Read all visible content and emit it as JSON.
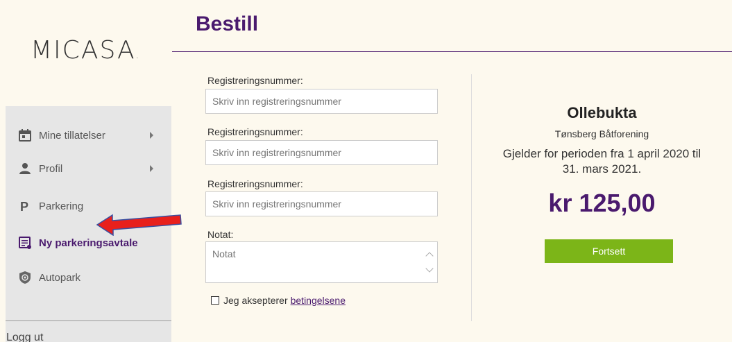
{
  "sidebar": {
    "logo": "MICASA",
    "logo_suffix": ".",
    "items": [
      {
        "label": "Mine tillatelser",
        "icon": "calendar-icon",
        "has_submenu": true,
        "active": false
      },
      {
        "label": "Profil",
        "icon": "person-icon",
        "has_submenu": true,
        "active": false
      },
      {
        "label": "Parkering",
        "icon": "parking-icon",
        "has_submenu": false,
        "active": false
      },
      {
        "label": "Ny parkeringsavtale",
        "icon": "document-icon",
        "has_submenu": false,
        "active": true
      },
      {
        "label": "Autopark",
        "icon": "shield-icon",
        "has_submenu": false,
        "active": false
      }
    ],
    "logout": "Logg ut"
  },
  "header": {
    "title": "Bestill"
  },
  "form": {
    "fields": [
      {
        "label": "Registreringsnummer:",
        "placeholder": "Skriv inn registreringsnummer"
      },
      {
        "label": "Registreringsnummer:",
        "placeholder": "Skriv inn registreringsnummer"
      },
      {
        "label": "Registreringsnummer:",
        "placeholder": "Skriv inn registreringsnummer"
      }
    ],
    "note_label": "Notat:",
    "note_placeholder": "Notat",
    "accept_text": "Jeg aksepterer",
    "terms_link": "betingelsene"
  },
  "summary": {
    "place": "Ollebukta",
    "association": "Tønsberg Båtforening",
    "period_line1": "Gjelder for perioden fra 1 april 2020 til",
    "period_line2": "31. mars 2021.",
    "price": "kr 125,00",
    "continue_label": "Fortsett"
  },
  "colors": {
    "brand_purple": "#4a1a6e",
    "button_green": "#7cb518",
    "annotation_red": "#e8201c"
  }
}
